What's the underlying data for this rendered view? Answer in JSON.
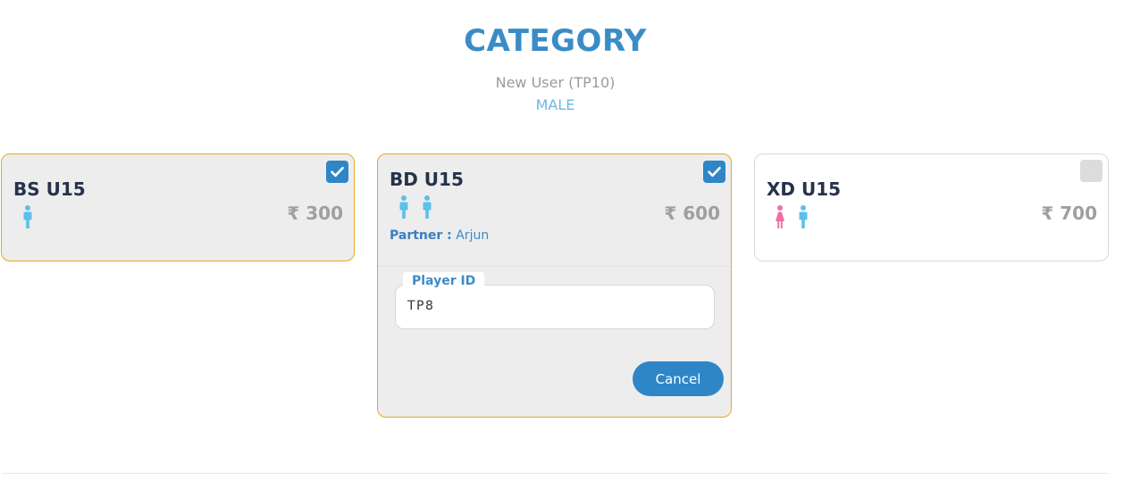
{
  "header": {
    "title": "CATEGORY",
    "subtitle": "New User (TP10)",
    "gender": "MALE"
  },
  "colors": {
    "accent": "#3a8cc6",
    "selected_border": "#e8a823",
    "male_icon": "#5cc0ea",
    "female_icon": "#f06fa8"
  },
  "categories": [
    {
      "name": "BS U15",
      "price": "₹ 300",
      "checked": true,
      "icons": [
        "male-player-icon"
      ]
    },
    {
      "name": "BD U15",
      "price": "₹ 600",
      "checked": true,
      "icons": [
        "male-player-icon",
        "male-player-icon"
      ],
      "partner_label": "Partner :",
      "partner_name": "Arjun",
      "player_id_label": "Player ID",
      "player_id_value": "TP8",
      "cancel_label": "Cancel"
    },
    {
      "name": "XD U15",
      "price": "₹ 700",
      "checked": false,
      "icons": [
        "female-player-icon",
        "male-player-icon"
      ]
    }
  ]
}
